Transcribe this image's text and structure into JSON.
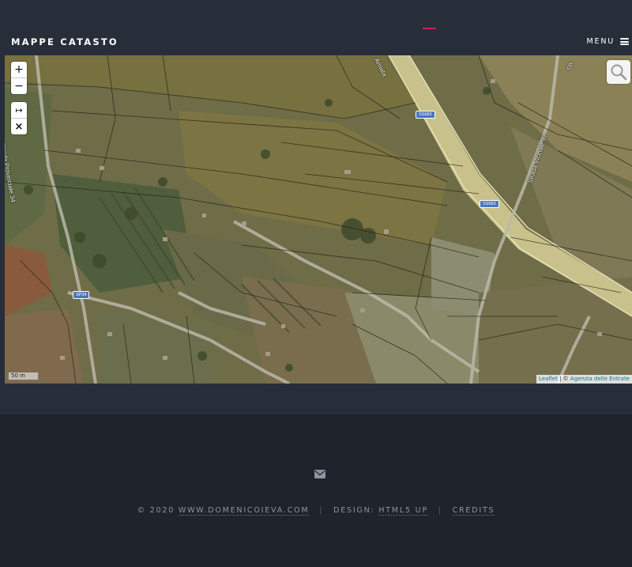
{
  "header": {
    "title": "MAPPE CATASTO",
    "menu_label": "MENU",
    "accent_color": "#c2275a"
  },
  "map": {
    "zoom_in_label": "+",
    "zoom_out_label": "−",
    "measure_label": "↦",
    "clear_label": "×",
    "scale_label": "50 m",
    "attribution_link": "Leaflet",
    "attribution_sep": " | © ",
    "attribution_source": "Agenzia delle Entrate",
    "labels": {
      "strada_provinciale": "Strada Provinciale 34",
      "strada_vicinale": "Strada Vicinale 97",
      "amiata": "Amiata",
      "str": "Str",
      "sp34": "SP34",
      "ss683_top": "SS683",
      "ss683_mid": "SS683"
    },
    "icons": [
      "search-icon",
      "measure-icon",
      "close-icon"
    ]
  },
  "footer": {
    "mail_icon": "envelope-icon",
    "copyright": "© 2020",
    "site_link": "WWW.DOMENICOIEVA.COM",
    "design_label": "DESIGN:",
    "design_link": "HTML5 UP",
    "credits_link": "CREDITS"
  }
}
